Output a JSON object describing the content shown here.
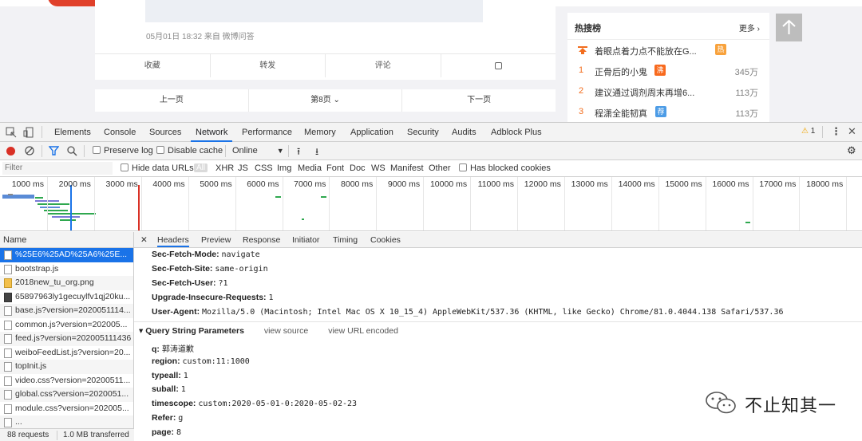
{
  "weibo": {
    "post_meta": "05月01日 18:32  来自 微博问答",
    "actions": [
      "收藏",
      "转发",
      "评论"
    ],
    "pager": {
      "prev": "上一页",
      "current": "第8页",
      "next": "下一页"
    },
    "hot": {
      "title": "热搜榜",
      "more": "更多",
      "items": [
        {
          "rank": "",
          "topic": "着眼点着力点不能放在G...",
          "tag": "热",
          "tag_color": "#f8a23c",
          "count": ""
        },
        {
          "rank": "1",
          "topic": "正骨后的小鬼",
          "tag": "沸",
          "tag_color": "#f86a1e",
          "count": "345万"
        },
        {
          "rank": "2",
          "topic": "建议通过调剂周末再增6...",
          "tag": "",
          "tag_color": "",
          "count": "113万"
        },
        {
          "rank": "3",
          "topic": "程潇全能韧真",
          "tag": "荐",
          "tag_color": "#4d9ce6",
          "count": "113万"
        }
      ]
    }
  },
  "devtools": {
    "tabs": [
      "Elements",
      "Console",
      "Sources",
      "Network",
      "Performance",
      "Memory",
      "Application",
      "Security",
      "Audits",
      "Adblock Plus"
    ],
    "active_tab": "Network",
    "warnings": "1",
    "toolbar": {
      "preserve_log": "Preserve log",
      "disable_cache": "Disable cache",
      "throttle": "Online"
    },
    "filter_placeholder": "Filter",
    "hide_data_urls": "Hide data URLs",
    "types": [
      "All",
      "XHR",
      "JS",
      "CSS",
      "Img",
      "Media",
      "Font",
      "Doc",
      "WS",
      "Manifest",
      "Other"
    ],
    "blocked_cookies": "Has blocked cookies",
    "timeline_ticks": [
      "1000 ms",
      "2000 ms",
      "3000 ms",
      "4000 ms",
      "5000 ms",
      "6000 ms",
      "7000 ms",
      "8000 ms",
      "9000 ms",
      "10000 ms",
      "11000 ms",
      "12000 ms",
      "13000 ms",
      "14000 ms",
      "15000 ms",
      "16000 ms",
      "17000 ms",
      "18000 ms",
      "1"
    ],
    "request_list": {
      "header": "Name",
      "items": [
        "%25E6%25AD%25A6%25E...",
        "bootstrap.js",
        "2018new_tu_org.png",
        "65897963ly1gecuylfv1qj20ku...",
        "base.js?version=2020051114...",
        "common.js?version=202005...",
        "feed.js?version=202005111436",
        "weiboFeedList.js?version=20...",
        "topInit.js",
        "video.css?version=20200511...",
        "global.css?version=2020051...",
        "module.css?version=202005...",
        "..."
      ],
      "requests": "88 requests",
      "transferred": "1.0 MB transferred"
    },
    "detail_tabs": [
      "Headers",
      "Preview",
      "Response",
      "Initiator",
      "Timing",
      "Cookies"
    ],
    "headers": [
      {
        "k": "Sec-Fetch-Mode:",
        "v": "navigate"
      },
      {
        "k": "Sec-Fetch-Site:",
        "v": "same-origin"
      },
      {
        "k": "Sec-Fetch-User:",
        "v": "?1"
      },
      {
        "k": "Upgrade-Insecure-Requests:",
        "v": "1"
      },
      {
        "k": "User-Agent:",
        "v": "Mozilla/5.0 (Macintosh; Intel Mac OS X 10_15_4) AppleWebKit/537.36 (KHTML, like Gecko) Chrome/81.0.4044.138 Safari/537.36"
      }
    ],
    "qsp": {
      "title": "▾ Query String Parameters",
      "view_source": "view source",
      "view_encoded": "view URL encoded"
    },
    "params": [
      {
        "k": "q:",
        "v": "郭涛道歉"
      },
      {
        "k": "region:",
        "v": "custom:11:1000"
      },
      {
        "k": "typeall:",
        "v": "1"
      },
      {
        "k": "suball:",
        "v": "1"
      },
      {
        "k": "timescope:",
        "v": "custom:2020-05-01-0:2020-05-02-23"
      },
      {
        "k": "Refer:",
        "v": "g"
      },
      {
        "k": "page:",
        "v": "8"
      }
    ],
    "watermark": "不止知其一"
  }
}
